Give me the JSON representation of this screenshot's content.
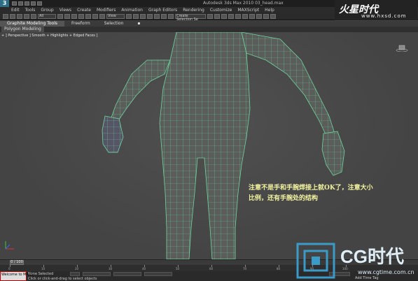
{
  "window": {
    "app_logo": "3",
    "title": "Autodesk 3ds Max 2010     03_head.max"
  },
  "menu": {
    "items": [
      "Edit",
      "Tools",
      "Group",
      "Views",
      "Create",
      "Modifiers",
      "Animation",
      "Graph Editors",
      "Rendering",
      "Customize",
      "MAXScript",
      "Help"
    ]
  },
  "toolbar": {
    "selection_filter": "All",
    "view_dropdown": "View",
    "named_selection": "Create Selection Se"
  },
  "ribbon": {
    "tabs": [
      "Graphite Modeling Tools",
      "Freeform",
      "Selection"
    ],
    "subtab": "Polygon Modeling"
  },
  "viewport": {
    "label": "+ ] Perspective ] Smooth + Highlights + Edged Faces ]",
    "note_line1": "注意不是手和手腕焊接上就OK了，注意大小",
    "note_line2": "比例，还有手腕处的结构",
    "mesh_color": "#6fd6a0",
    "body_color": "#5a5d59"
  },
  "watermarks": {
    "top_logo": "火星时代",
    "top_url": "www.hxsd.com",
    "bottom_logo": "CG时代",
    "bottom_url": "www.cgtime.com.cn"
  },
  "timeline": {
    "frame_display": "0 / 100",
    "ticks": [
      "0",
      "10",
      "20",
      "30",
      "40",
      "50",
      "60",
      "70",
      "80",
      "90",
      "100"
    ]
  },
  "status": {
    "maxscript": "Welcome to MAXS",
    "selection": "None Selected",
    "hint": "Click or click-and-drag to select objects",
    "add_time_tag": "Add Time Tag"
  }
}
